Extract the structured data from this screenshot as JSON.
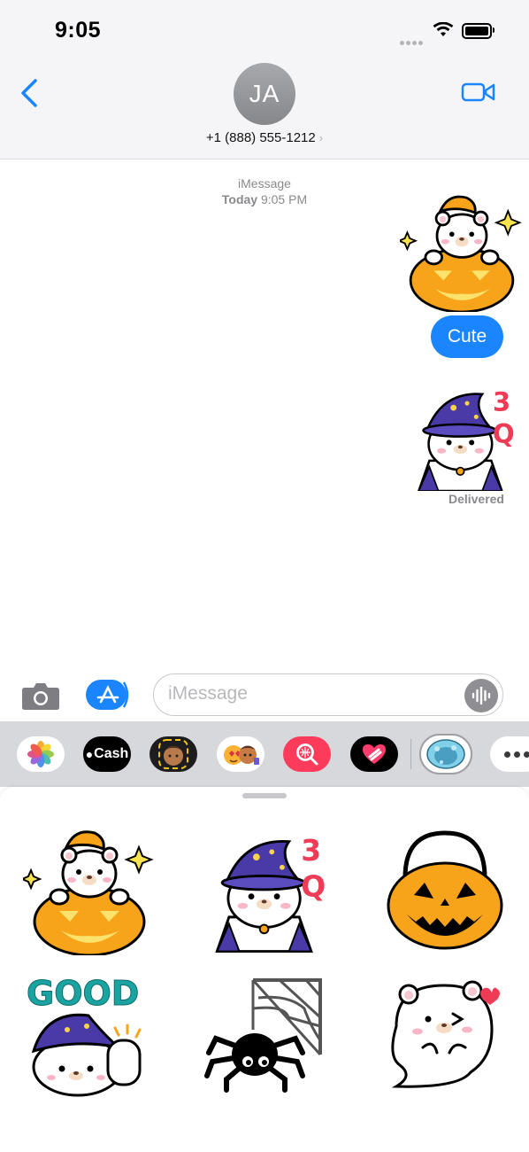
{
  "status": {
    "time": "9:05"
  },
  "header": {
    "avatar_initials": "JA",
    "contact": "+1 (888) 555-1212"
  },
  "conversation": {
    "service": "iMessage",
    "day": "Today",
    "time": "9:05 PM",
    "messages": [
      {
        "type": "sticker",
        "sticker": "bear-in-pumpkin-sticker"
      },
      {
        "type": "text",
        "text": "Cute"
      },
      {
        "type": "sticker",
        "sticker": "bear-wizard-3q-sticker"
      }
    ],
    "delivered": "Delivered"
  },
  "composer": {
    "placeholder": "iMessage"
  },
  "app_drawer": {
    "apps": [
      {
        "name": "photos-app-icon"
      },
      {
        "name": "apple-cash-app-icon",
        "label": "Cash"
      },
      {
        "name": "memoji-app-icon"
      },
      {
        "name": "animoji-app-icon"
      },
      {
        "name": "image-search-app-icon"
      },
      {
        "name": "digital-touch-app-icon"
      },
      {
        "name": "sticker-pack-app-icon"
      },
      {
        "name": "more-apps-icon"
      }
    ]
  },
  "sticker_panel": {
    "stickers": [
      {
        "name": "bear-in-pumpkin-sticker"
      },
      {
        "name": "bear-wizard-3q-sticker",
        "text": "3Q"
      },
      {
        "name": "jack-o-lantern-bucket-sticker"
      },
      {
        "name": "good-bear-thumbs-up-sticker",
        "text": "GOOD"
      },
      {
        "name": "spider-web-sticker"
      },
      {
        "name": "ghost-bear-heart-sticker"
      }
    ]
  },
  "colors": {
    "accent": "#1a85ff",
    "pumpkin": "#f8a41b",
    "hat": "#4a3aa8",
    "good_text": "#1aa3a0"
  }
}
